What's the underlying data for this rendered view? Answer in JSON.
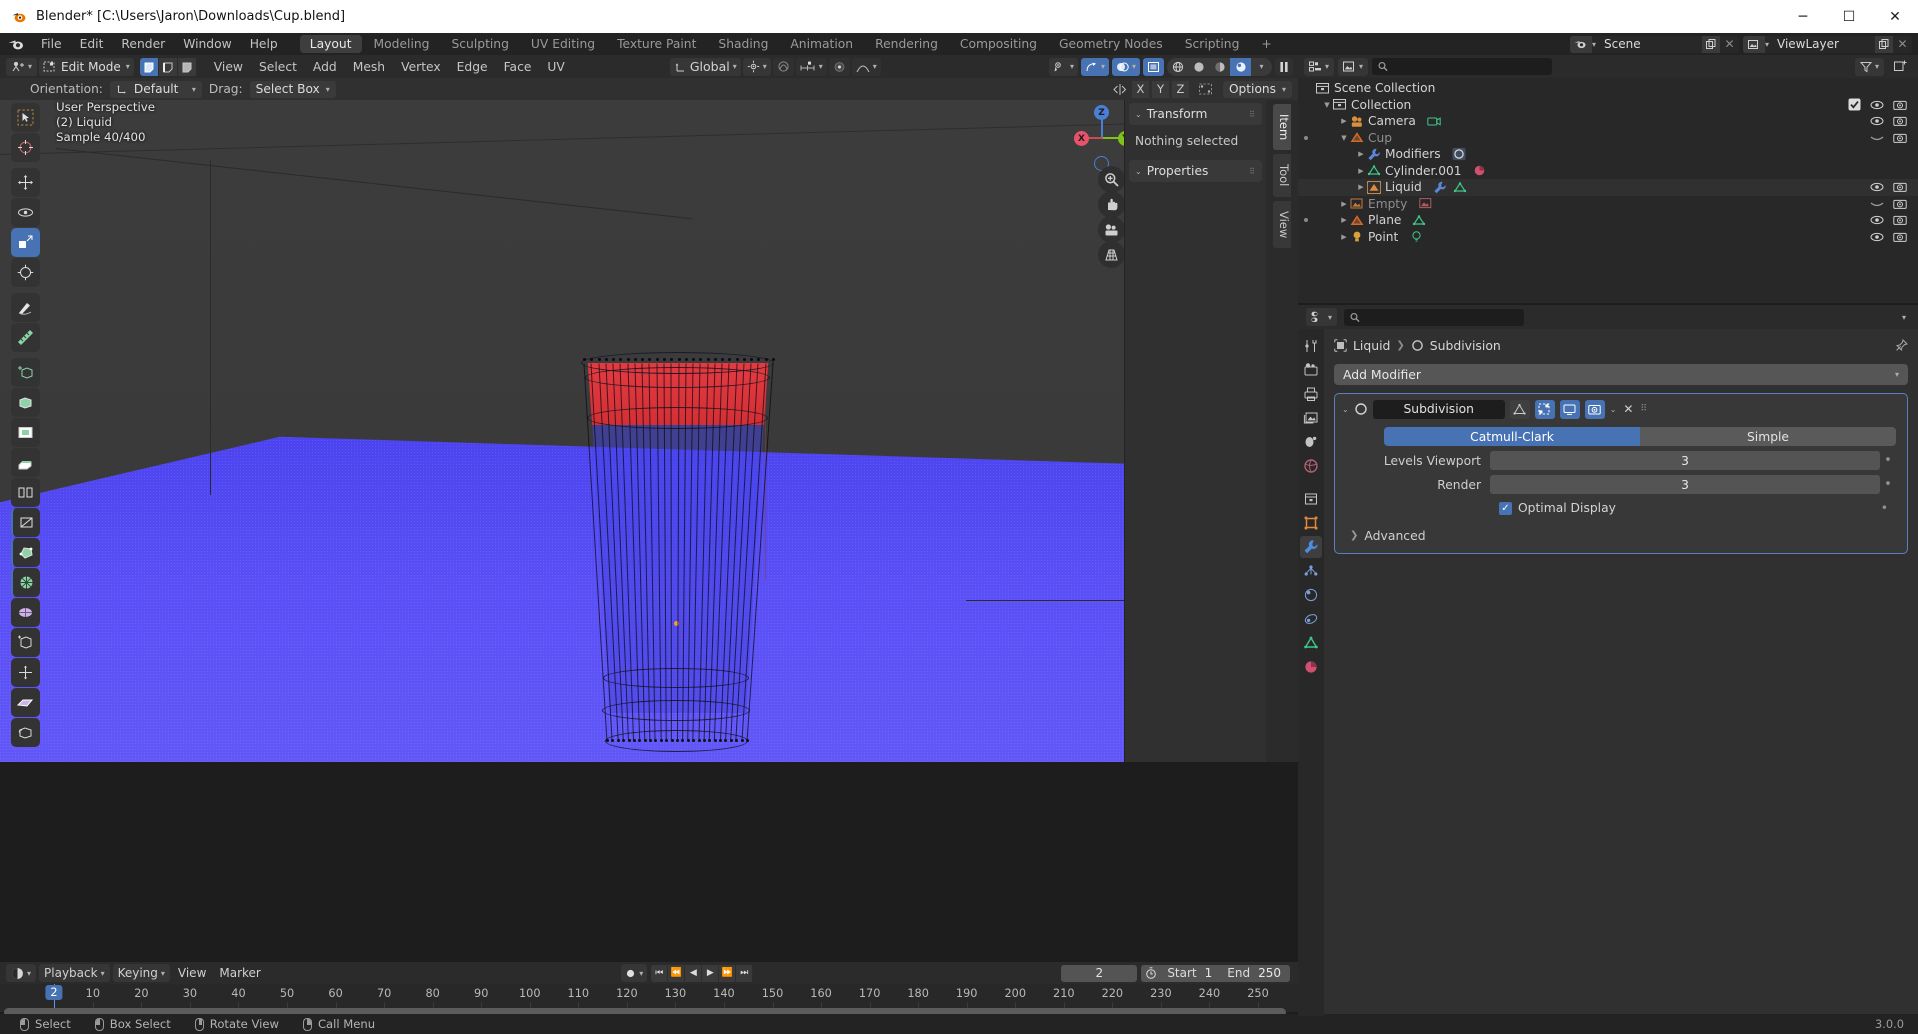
{
  "window": {
    "title": "Blender* [C:\\Users\\Jaron\\Downloads\\Cup.blend]",
    "minimize": "─",
    "maximize": "☐",
    "close": "✕",
    "version": "3.0.0"
  },
  "top_menu": {
    "items": [
      "File",
      "Edit",
      "Render",
      "Window",
      "Help"
    ],
    "workspaces": [
      {
        "label": "Layout",
        "active": true
      },
      {
        "label": "Modeling",
        "active": false
      },
      {
        "label": "Sculpting",
        "active": false
      },
      {
        "label": "UV Editing",
        "active": false
      },
      {
        "label": "Texture Paint",
        "active": false
      },
      {
        "label": "Shading",
        "active": false
      },
      {
        "label": "Animation",
        "active": false
      },
      {
        "label": "Rendering",
        "active": false
      },
      {
        "label": "Compositing",
        "active": false
      },
      {
        "label": "Geometry Nodes",
        "active": false
      },
      {
        "label": "Scripting",
        "active": false
      },
      {
        "label": "+",
        "active": false
      }
    ],
    "scene_name": "Scene",
    "viewlayer_name": "ViewLayer"
  },
  "viewport_header": {
    "mode": "Edit Mode",
    "menus": [
      "View",
      "Select",
      "Add",
      "Mesh",
      "Vertex",
      "Edge",
      "Face",
      "UV"
    ],
    "transform_orientation": "Global",
    "select_modes": [
      "vertex-select",
      "edge-select",
      "face-select"
    ],
    "active_select_mode": 0
  },
  "tool_settings": {
    "orientation_label": "Orientation:",
    "orientation_value": "Default",
    "drag_label": "Drag:",
    "drag_value": "Select Box",
    "axis_buttons": [
      "X",
      "Y",
      "Z"
    ],
    "options_label": "Options"
  },
  "viewport": {
    "overlay_lines": [
      "User Perspective",
      "(2) Liquid",
      "Sample 40/400"
    ],
    "gizmo_axes": [
      "Z",
      "X",
      "Y"
    ],
    "colors": {
      "water": "#4b43ef",
      "liquid_selected": "#f03a3a",
      "liquid_unselected": "#4646eb",
      "background": "#3c3c3c"
    }
  },
  "n_panel": {
    "sections": [
      {
        "title": "Transform",
        "body": "Nothing selected"
      },
      {
        "title": "Properties",
        "body": ""
      }
    ],
    "tabs": [
      {
        "label": "Item",
        "active": true
      },
      {
        "label": "Tool",
        "active": false
      },
      {
        "label": "View",
        "active": false
      }
    ]
  },
  "outliner": {
    "search_placeholder": "",
    "rows": [
      {
        "label": "Scene Collection",
        "depth": 0,
        "icon": "collection-icon",
        "dim": false,
        "expand": "",
        "extras": [],
        "vis": []
      },
      {
        "label": "Collection",
        "depth": 1,
        "icon": "collection-icon",
        "dim": false,
        "expand": "down",
        "extras": [],
        "vis": [
          "checkbox",
          "eye",
          "camera"
        ]
      },
      {
        "label": "Camera",
        "depth": 2,
        "icon": "camera-object-icon",
        "dim": false,
        "expand": "right",
        "extras": [
          "camera-data-icon"
        ],
        "vis": [
          "eye",
          "camera"
        ]
      },
      {
        "label": "Cup",
        "depth": 2,
        "icon": "mesh-object-icon",
        "dim": true,
        "expand": "down",
        "extras": [],
        "vis": [
          "eye-closed",
          "camera"
        ]
      },
      {
        "label": "Modifiers",
        "depth": 3,
        "icon": "wrench-icon",
        "dim": false,
        "expand": "right",
        "extras": [
          "subsurf-icon"
        ],
        "vis": []
      },
      {
        "label": "Cylinder.001",
        "depth": 3,
        "icon": "mesh-data-icon",
        "dim": false,
        "expand": "right",
        "extras": [
          "material-icon"
        ],
        "vis": []
      },
      {
        "label": "Liquid",
        "depth": 3,
        "icon": "mesh-object-icon-active",
        "dim": false,
        "expand": "right",
        "extras": [
          "wrench-icon",
          "mesh-data-icon"
        ],
        "vis": [
          "eye",
          "camera"
        ]
      },
      {
        "label": "Empty",
        "depth": 2,
        "icon": "empty-image-icon",
        "dim": true,
        "expand": "right",
        "extras": [
          "image-icon"
        ],
        "vis": [
          "eye-closed",
          "camera"
        ]
      },
      {
        "label": "Plane",
        "depth": 2,
        "icon": "mesh-object-icon",
        "dim": false,
        "expand": "right",
        "extras": [
          "mesh-data-icon"
        ],
        "vis": [
          "eye",
          "camera"
        ]
      },
      {
        "label": "Point",
        "depth": 2,
        "icon": "light-object-icon",
        "dim": false,
        "expand": "right",
        "extras": [
          "light-data-icon"
        ],
        "vis": [
          "eye",
          "camera"
        ]
      }
    ]
  },
  "properties": {
    "search_placeholder": "",
    "breadcrumb": [
      "Liquid",
      "Subdivision"
    ],
    "add_modifier_label": "Add Modifier",
    "tabs": [
      {
        "name": "tool",
        "active": false
      },
      {
        "name": "render",
        "active": false
      },
      {
        "name": "output",
        "active": false
      },
      {
        "name": "view-layer",
        "active": false
      },
      {
        "name": "scene",
        "active": false
      },
      {
        "name": "world",
        "active": false
      },
      {
        "name": "collection",
        "active": false
      },
      {
        "name": "object",
        "active": false
      },
      {
        "name": "modifiers",
        "active": true
      },
      {
        "name": "particles",
        "active": false
      },
      {
        "name": "physics",
        "active": false
      },
      {
        "name": "constraints",
        "active": false
      },
      {
        "name": "data",
        "active": false
      },
      {
        "name": "material",
        "active": false
      }
    ],
    "modifier": {
      "name": "Subdivision",
      "type_options": [
        {
          "label": "Catmull-Clark",
          "active": true
        },
        {
          "label": "Simple",
          "active": false
        }
      ],
      "fields": [
        {
          "label": "Levels Viewport",
          "value": "3"
        },
        {
          "label": "Render",
          "value": "3"
        }
      ],
      "checkbox": {
        "label": "Optimal Display",
        "checked": true
      },
      "advanced_label": "Advanced",
      "toggles": [
        {
          "name": "on-cage",
          "on": false
        },
        {
          "name": "edit-mode-display",
          "on": true
        },
        {
          "name": "realtime-display",
          "on": true
        },
        {
          "name": "render-display",
          "on": true
        }
      ],
      "close_label": "✕"
    }
  },
  "timeline": {
    "menus": [
      "Playback",
      "Keying",
      "View",
      "Marker"
    ],
    "current_frame": "2",
    "start_label": "Start",
    "start_value": "1",
    "end_label": "End",
    "end_value": "250",
    "ticks": [
      10,
      20,
      30,
      40,
      50,
      60,
      70,
      80,
      90,
      100,
      110,
      120,
      130,
      140,
      150,
      160,
      170,
      180,
      190,
      200,
      210,
      220,
      230,
      240,
      250
    ],
    "playhead_frame": 2,
    "transport": [
      "⏮",
      "⏪",
      "◀",
      "▶",
      "⏩",
      "⏭"
    ]
  },
  "status_bar": {
    "items": [
      {
        "mouse": "left",
        "label": "Select"
      },
      {
        "mouse": "left",
        "label": "Box Select"
      },
      {
        "mouse": "middle",
        "label": "Rotate View"
      },
      {
        "mouse": "right",
        "label": "Call Menu"
      }
    ]
  }
}
